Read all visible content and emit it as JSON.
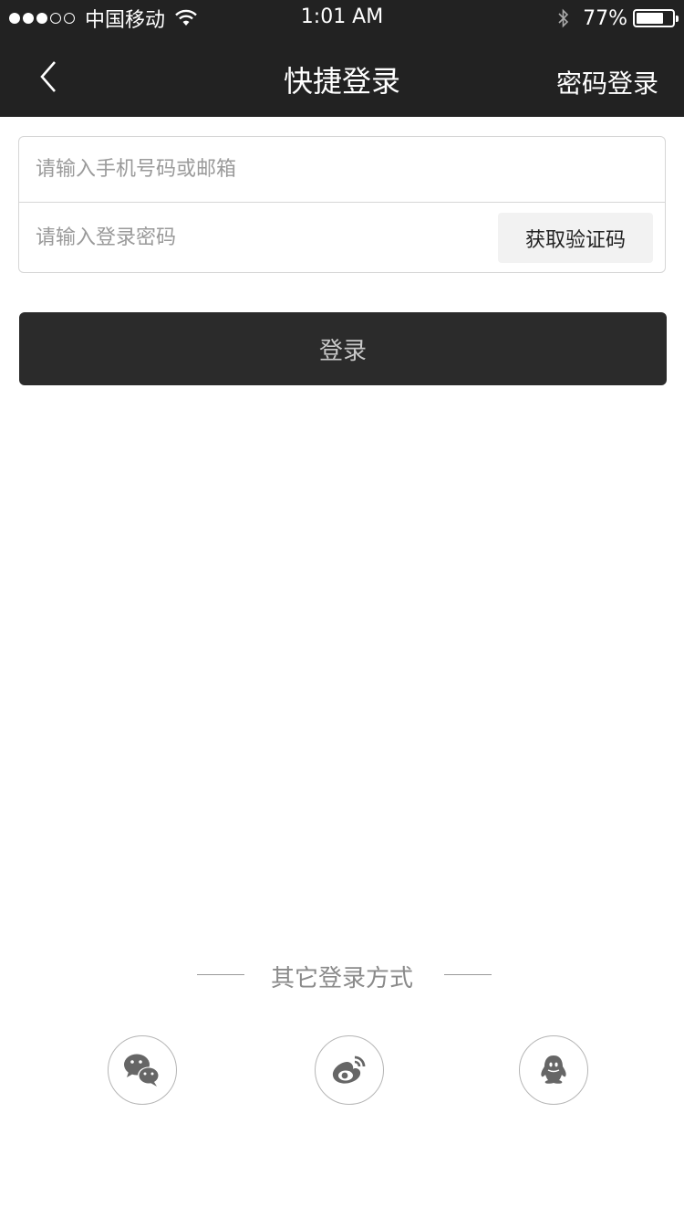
{
  "status_bar": {
    "carrier": "中国移动",
    "time": "1:01 AM",
    "battery_pct": "77%",
    "battery_level": 0.77
  },
  "nav": {
    "title": "快捷登录",
    "right_link": "密码登录"
  },
  "form": {
    "account_placeholder": "请输入手机号码或邮箱",
    "password_placeholder": "请输入登录密码",
    "get_code_label": "获取验证码"
  },
  "login_button": "登录",
  "other_login": {
    "label": "其它登录方式",
    "icons": [
      "wechat-icon",
      "weibo-icon",
      "qq-icon"
    ]
  },
  "colors": {
    "topbar": "#222222",
    "button": "#2b2b2b",
    "icon_gray": "#666666"
  }
}
